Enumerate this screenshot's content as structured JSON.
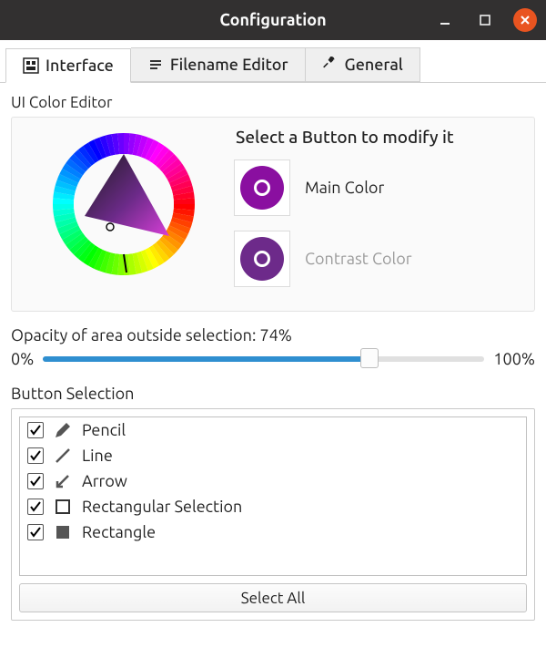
{
  "window": {
    "title": "Configuration"
  },
  "tabs": [
    {
      "label": "Interface",
      "active": true
    },
    {
      "label": "Filename Editor",
      "active": false
    },
    {
      "label": "General",
      "active": false
    }
  ],
  "sections": {
    "ui_color_editor": {
      "label": "UI Color Editor",
      "prompt": "Select a Button to modify it",
      "main_color": {
        "label": "Main Color",
        "hex": "#8a0fa0",
        "selected": true
      },
      "contrast_color": {
        "label": "Contrast Color",
        "hex": "#6d2a8a",
        "selected": false
      }
    },
    "opacity": {
      "label_prefix": "Opacity of area outside selection: ",
      "value_pct": 74,
      "min_label": "0%",
      "max_label": "100%"
    },
    "button_selection": {
      "label": "Button Selection",
      "items": [
        {
          "checked": true,
          "icon": "pencil-icon",
          "label": "Pencil"
        },
        {
          "checked": true,
          "icon": "line-icon",
          "label": "Line"
        },
        {
          "checked": true,
          "icon": "arrow-icon",
          "label": "Arrow"
        },
        {
          "checked": true,
          "icon": "rect-outline-icon",
          "label": "Rectangular Selection"
        },
        {
          "checked": true,
          "icon": "rect-fill-icon",
          "label": "Rectangle"
        }
      ],
      "select_all_label": "Select All"
    }
  }
}
